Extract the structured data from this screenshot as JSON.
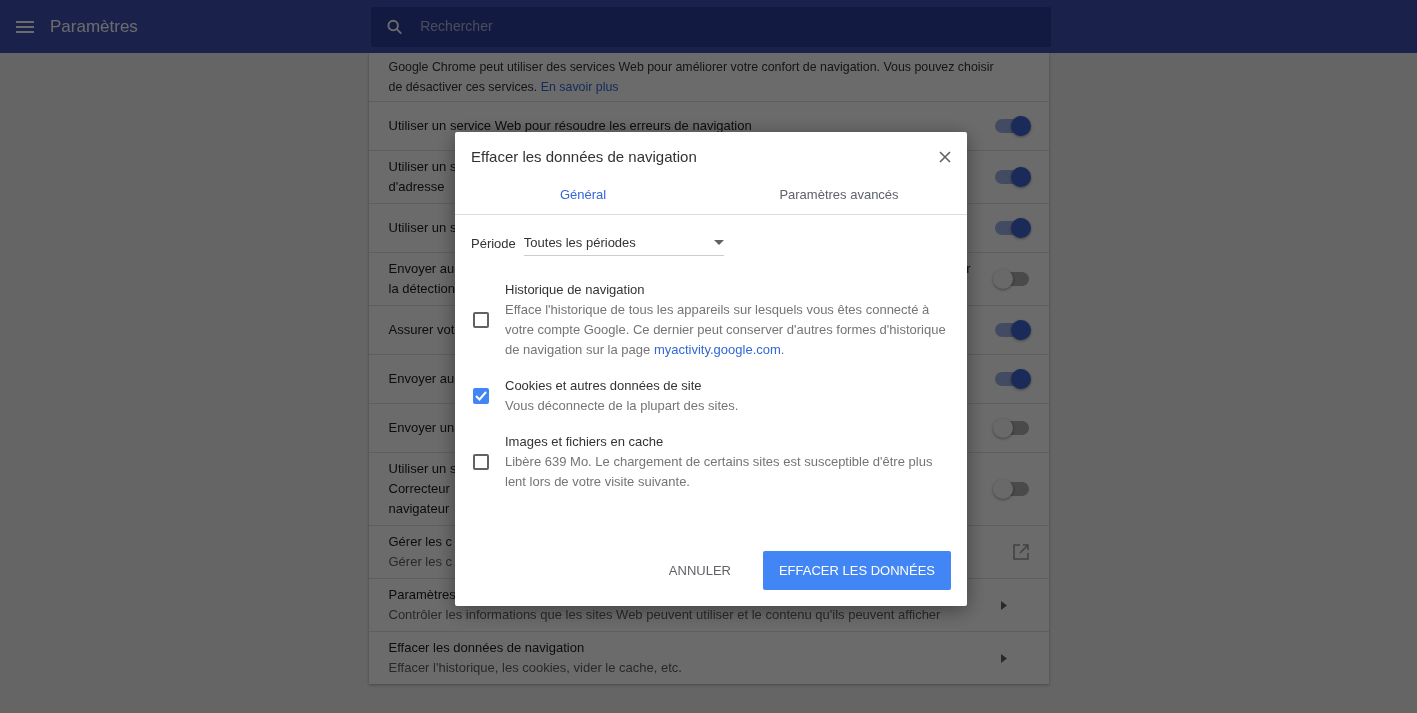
{
  "header": {
    "title": "Paramètres",
    "search": {
      "placeholder": "Rechercher"
    }
  },
  "intro": {
    "lines": [
      "Google Chrome peut utiliser des services Web pour améliorer votre confort de navigation. Vous pouvez choisir",
      "de désactiver ces services."
    ],
    "link": "En savoir plus"
  },
  "settings": [
    {
      "kind": "toggle",
      "lines": [
        "Utiliser un service Web pour résoudre les erreurs de navigation"
      ],
      "on": true
    },
    {
      "kind": "toggle",
      "lines": [
        "Utiliser un s",
        "d'adresse"
      ],
      "on": true
    },
    {
      "kind": "toggle",
      "lines": [
        "Utiliser un s"
      ],
      "on": true
    },
    {
      "kind": "toggle",
      "lines": [
        "Envoyer au",
        "la détection"
      ],
      "trailing": "r",
      "on": false
    },
    {
      "kind": "toggle",
      "lines": [
        "Assurer vot"
      ],
      "on": true
    },
    {
      "kind": "toggle",
      "lines": [
        "Envoyer au"
      ],
      "on": true
    },
    {
      "kind": "toggle",
      "lines": [
        "Envoyer un"
      ],
      "on": false
    },
    {
      "kind": "toggle",
      "lines": [
        "Utiliser un s",
        "Correcteur",
        "navigateur"
      ],
      "on": false
    },
    {
      "kind": "external",
      "lines": [
        "Gérer les c",
        "Gérer les c"
      ]
    },
    {
      "kind": "arrow",
      "lines": [
        "Paramètres",
        "Contrôler les informations que les sites Web peuvent utiliser et le contenu qu'ils peuvent afficher"
      ]
    },
    {
      "kind": "arrow",
      "lines": [
        "Effacer les données de navigation",
        "Effacer l'historique, les cookies, vider le cache, etc."
      ]
    }
  ],
  "dialog": {
    "title": "Effacer les données de navigation",
    "tabs": [
      {
        "label": "Général",
        "selected": true
      },
      {
        "label": "Paramètres avancés",
        "selected": false
      }
    ],
    "period": {
      "label": "Période",
      "value": "Toutes les périodes"
    },
    "items": [
      {
        "title": "Historique de navigation",
        "description": "Efface l'historique de tous les appareils sur lesquels vous êtes connecté à votre compte Google. Ce dernier peut conserver d'autres formes d'historique de navigation sur la page",
        "link": "myactivity.google.com",
        "after": ".",
        "checked": false
      },
      {
        "title": "Cookies et autres données de site",
        "description": "Vous déconnecte de la plupart des sites.",
        "checked": true
      },
      {
        "title": "Images et fichiers en cache",
        "description": "Libère 639 Mo. Le chargement de certains sites est susceptible d'être plus lent lors de votre visite suivante.",
        "checked": false
      }
    ],
    "buttons": [
      {
        "label": "ANNULER",
        "kind": "text"
      },
      {
        "label": "EFFACER LES DONNÉES",
        "kind": "primary"
      }
    ]
  }
}
